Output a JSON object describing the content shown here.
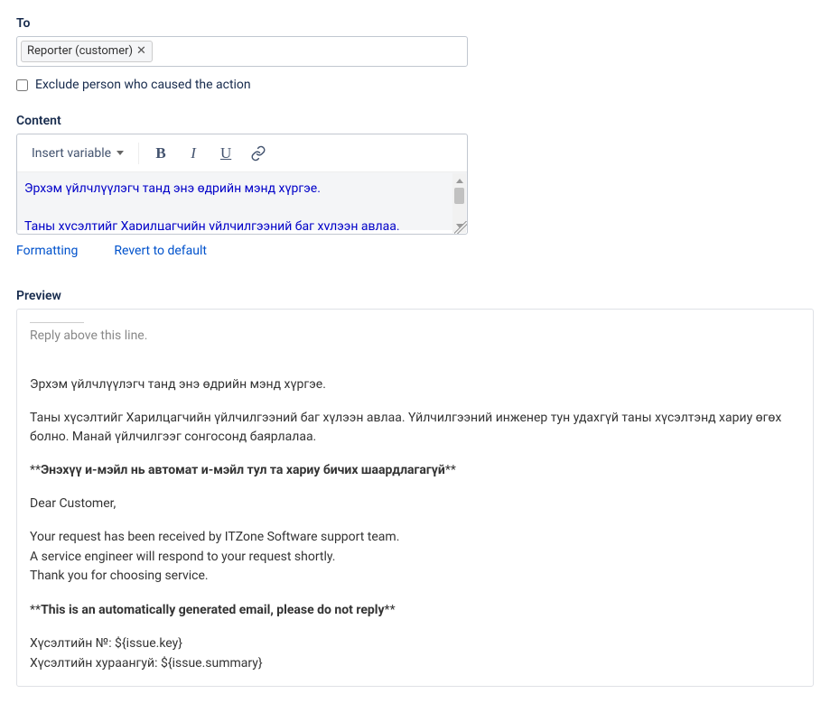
{
  "to": {
    "label": "To",
    "recipient": "Reporter (customer)"
  },
  "exclude": {
    "label": "Exclude person who caused the action",
    "checked": false
  },
  "content": {
    "label": "Content",
    "toolbar": {
      "insert_variable": "Insert variable",
      "bold": "B",
      "italic": "I",
      "underline": "U"
    },
    "body": "Эрхэм үйлчлүүлэгч танд энэ өдрийн мэнд хүргэе.\n\nТаны хүсэлтийг Харилцагчийн үйлчилгээний баг хүлээн авлаа."
  },
  "links": {
    "formatting": "Formatting",
    "revert": "Revert to default"
  },
  "preview": {
    "label": "Preview",
    "reply_above": "Reply above this line.",
    "p1": "Эрхэм үйлчлүүлэгч танд энэ өдрийн мэнд хүргэе.",
    "p2": "Таны хүсэлтийг Харилцагчийн үйлчилгээний баг хүлээн авлаа. Үйлчилгээний инженер тун удахгүй таны хүсэлтэнд хариу өгөх болно. Манай үйлчилгээг сонгосонд баярлалаа.",
    "p3_prefix": "**",
    "p3_bold": "Энэхүү и-мэйл нь автомат и-мэйл тул та хариу бичих шаардлагагүй",
    "p3_suffix": "**",
    "p4": "Dear Customer,",
    "p5a": "Your request has been received by ITZone Software support team.",
    "p5b": "A service engineer will respond to your request shortly.",
    "p5c": "Thank you for choosing service.",
    "p6_prefix": "**",
    "p6_bold": "This is an automatically generated email, please do not reply",
    "p6_suffix": "**",
    "p7a": "Хүсэлтийн №: ${issue.key}",
    "p7b": "Хүсэлтийн хураангуй: ${issue.summary}"
  }
}
